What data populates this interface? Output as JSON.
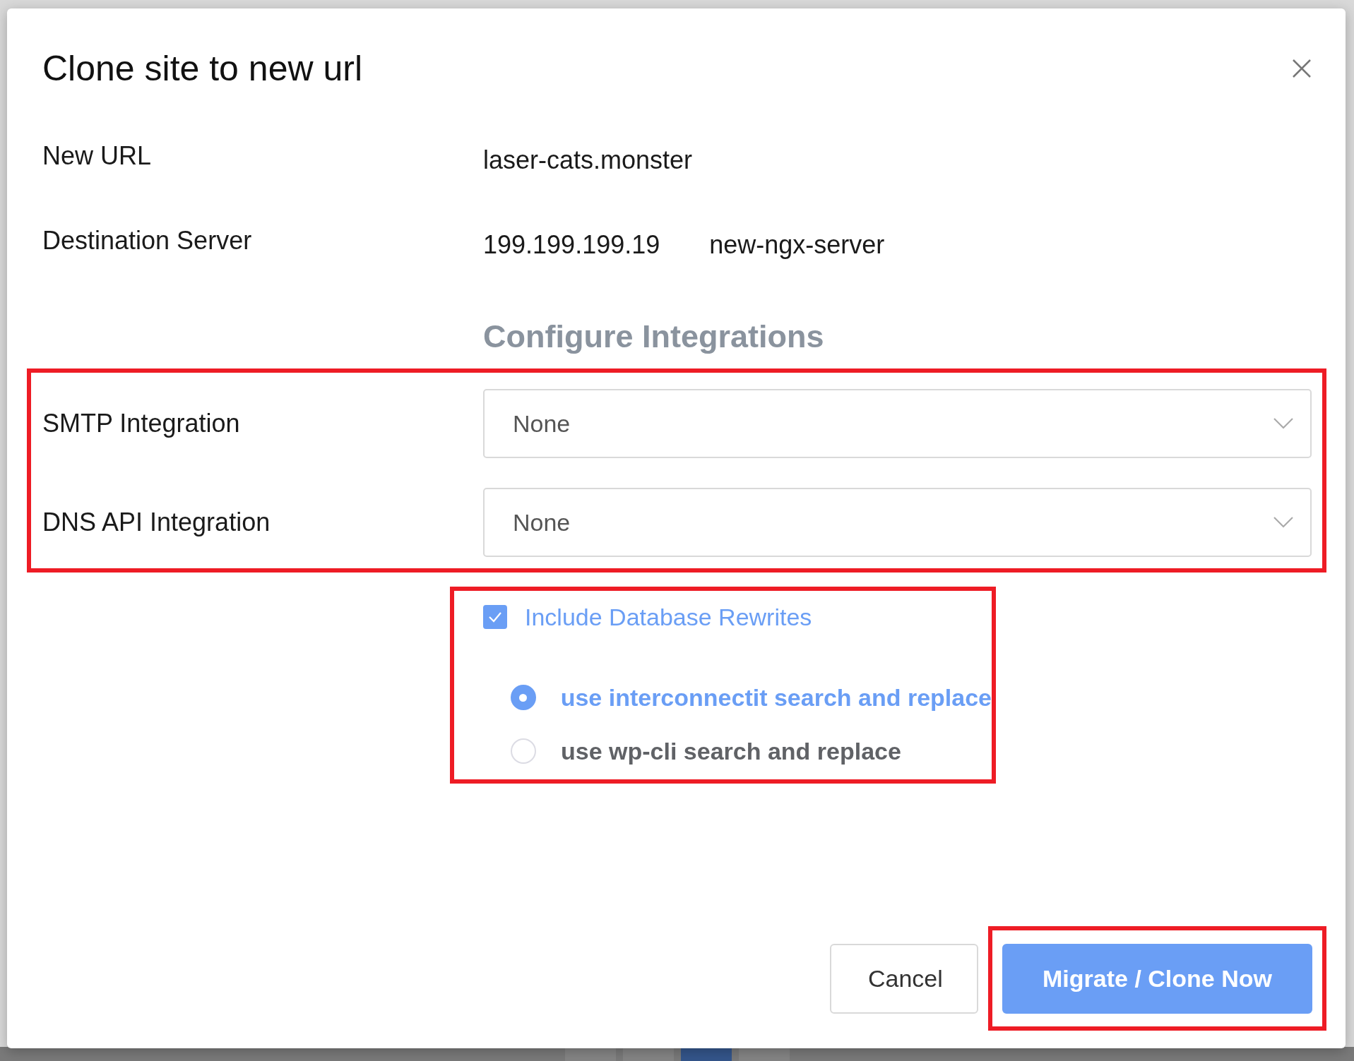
{
  "dialog": {
    "title": "Clone site to new url"
  },
  "details": [
    {
      "label": "New URL",
      "values": [
        "laser-cats.monster"
      ]
    },
    {
      "label": "Destination Server",
      "values": [
        "199.199.199.19",
        "new-ngx-server"
      ]
    }
  ],
  "section_title": "Configure Integrations",
  "integrations": [
    {
      "label": "SMTP Integration",
      "value": "None"
    },
    {
      "label": "DNS API Integration",
      "value": "None"
    }
  ],
  "database_rewrites": {
    "label": "Include Database Rewrites",
    "checked": true,
    "options": [
      {
        "label": "use interconnectit search and replace",
        "selected": true
      },
      {
        "label": "use wp-cli search and replace",
        "selected": false
      }
    ]
  },
  "buttons": [
    {
      "label": "Cancel",
      "kind": "secondary"
    },
    {
      "label": "Migrate / Clone Now",
      "kind": "primary"
    }
  ]
}
